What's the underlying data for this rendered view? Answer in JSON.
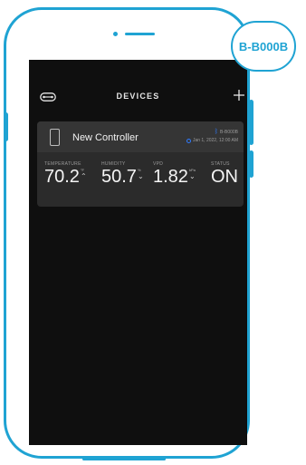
{
  "colors": {
    "accent": "#1fa3d3",
    "screen_bg": "#0f0f0f",
    "card_bg": "#2b2b2b",
    "bluetooth": "#2f7bff"
  },
  "badge": {
    "text": "B-B000B"
  },
  "header": {
    "title": "DEVICES",
    "left_icon": "controller-toggle-icon",
    "right_icon": "plus-icon"
  },
  "device": {
    "name": "New Controller",
    "icon": "phone-device-icon",
    "bt_id": "B-B000B",
    "timestamp": "Jan 1, 2022, 12:00 AM",
    "metrics": [
      {
        "label": "TEMPERATURE",
        "value": "70.2",
        "unit": "°F",
        "arrow": "up"
      },
      {
        "label": "HUMIDITY",
        "value": "50.7",
        "unit": "%",
        "arrow": "down"
      },
      {
        "label": "VPD",
        "value": "1.82",
        "unit": "kPa",
        "arrow": "down"
      },
      {
        "label": "STATUS",
        "value": "ON",
        "unit": "",
        "arrow": ""
      }
    ]
  }
}
